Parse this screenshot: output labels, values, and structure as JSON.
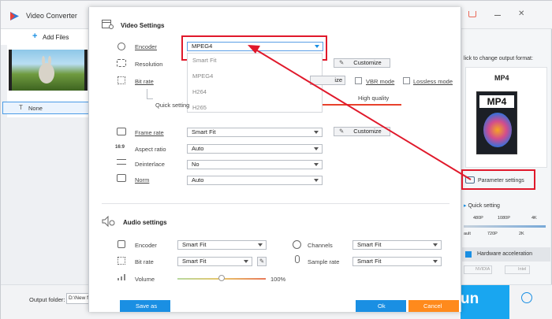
{
  "app": {
    "title": "Video Converter",
    "add_files_label": "Add Files",
    "file_item_label": "None",
    "output_format_hint": "lick to change output format:",
    "output_format": "MP4",
    "format_icon_text": "MP4",
    "parameter_settings_label": "Parameter settings",
    "quick_setting_label": "Quick setting",
    "quality_marks": [
      "480P",
      "1080P",
      "4K"
    ],
    "quality_marks_lower": [
      "ault",
      "720P",
      "2K"
    ],
    "hw_accel_label": "Hardware acceleration",
    "nvidia_label": "NVIDIA",
    "intel_label": "Intel",
    "output_folder_label": "Output folder:",
    "output_folder_value": "D:\\New fo",
    "run_partial": "un"
  },
  "dialog": {
    "video_settings_title": "Video Settings",
    "encoder_label": "Encoder",
    "encoder_value": "MPEG4",
    "encoder_options": [
      "Smart Fit",
      "MPEG4",
      "H264",
      "H265"
    ],
    "resolution_label": "Resolution",
    "customize_label": "Customize",
    "bitrate_label": "Bit rate",
    "bitrate_partial_btn": "ize",
    "vbr_label": "VBR mode",
    "lossless_label": "Lossless mode",
    "quick_setting_label": "Quick setting",
    "high_quality_label": "High quality",
    "framerate_label": "Frame rate",
    "framerate_value": "Smart Fit",
    "aspect_label": "Aspect ratio",
    "aspect_value": "Auto",
    "deinterlace_label": "Deinterlace",
    "deinterlace_value": "No",
    "norm_label": "Norm",
    "norm_value": "Auto",
    "audio_settings_title": "Audio settings",
    "audio_encoder_label": "Encoder",
    "audio_encoder_value": "Smart Fit",
    "channels_label": "Channels",
    "channels_value": "Smart Fit",
    "audio_bitrate_label": "Bit rate",
    "audio_bitrate_value": "Smart Fit",
    "sample_rate_label": "Sample rate",
    "sample_rate_value": "Smart Fit",
    "volume_label": "Volume",
    "volume_value": "100%",
    "volume_level": 0.5,
    "save_as_label": "Save as",
    "ok_label": "Ok",
    "cancel_label": "Cancel"
  },
  "colors": {
    "accent_blue": "#1a8fe3",
    "cancel_orange": "#ff8a1c",
    "highlight_red": "#e0192b",
    "run_blue": "#19a6f0"
  }
}
